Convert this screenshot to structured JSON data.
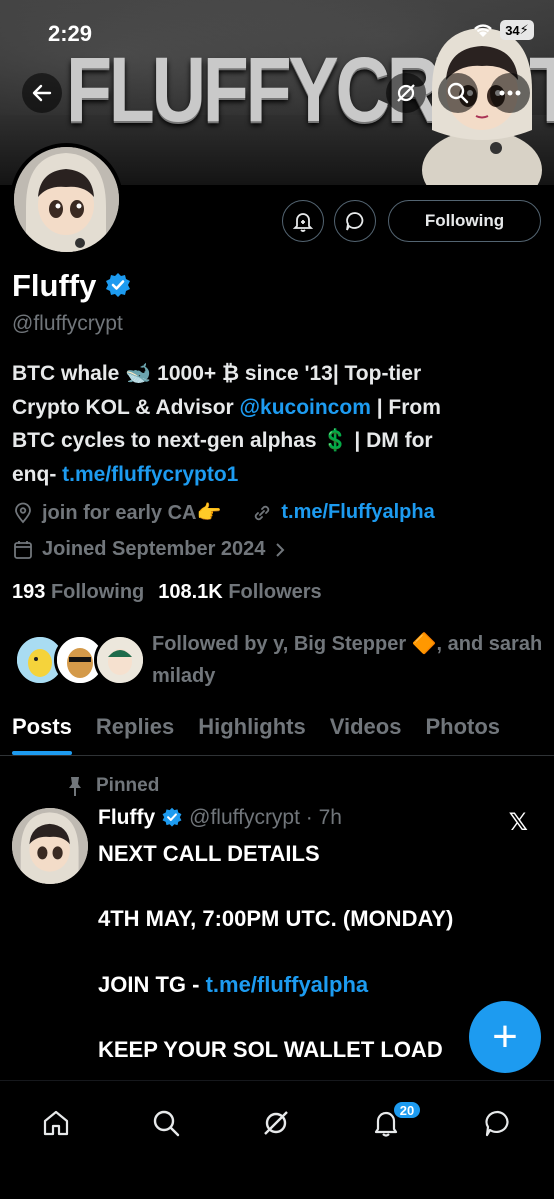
{
  "status_bar": {
    "time": "2:29",
    "battery": "34"
  },
  "banner": {
    "text": "FLUFFYCRYPT"
  },
  "profile": {
    "name": "Fluffy",
    "handle": "@fluffycrypt",
    "follow_button": "Following",
    "bio": {
      "line1": "BTC whale 🐋 1000+ ₿ since '13| Top-tier",
      "line2_pre": "Crypto KOL & Advisor ",
      "line2_link": "@kucoincom",
      "line2_post": " | From",
      "line3": "BTC cycles to next-gen alphas 💲 | DM for",
      "line4_pre": "enq- ",
      "line4_link": "t.me/fluffycrypto1"
    },
    "location": "join for early CA👉",
    "website": "t.me/Fluffyalpha",
    "joined": "Joined September 2024",
    "following_count": "193",
    "following_label": "Following",
    "followers_count": "108.1K",
    "followers_label": "Followers",
    "followed_by": "Followed by y, Big Stepper 🔶, and sarah milady"
  },
  "tabs": [
    "Posts",
    "Replies",
    "Highlights",
    "Videos",
    "Photos"
  ],
  "post": {
    "pinned_label": "Pinned",
    "author": "Fluffy",
    "handle_time": "@fluffycrypt · 7h",
    "line1": "NEXT CALL DETAILS",
    "line2": "4TH MAY, 7:00PM UTC. (MONDAY)",
    "line3_pre": "JOIN TG - ",
    "line3_link": "t.me/fluffyalpha",
    "line4": "KEEP YOUR SOL WALLET LOAD"
  },
  "fab_label": "+",
  "notifications_badge": "20",
  "colors": {
    "accent": "#1d9bf0",
    "background": "#000000",
    "muted": "#71767b"
  },
  "icons": [
    "back-arrow-icon",
    "grok-icon",
    "search-icon",
    "more-icon",
    "notification-bell-icon",
    "message-icon",
    "verified-badge-icon",
    "location-icon",
    "link-icon",
    "calendar-icon",
    "chevron-right-icon",
    "pin-icon",
    "x-logo-icon",
    "home-icon",
    "search-nav-icon",
    "grok-nav-icon",
    "notifications-icon",
    "messages-icon"
  ]
}
